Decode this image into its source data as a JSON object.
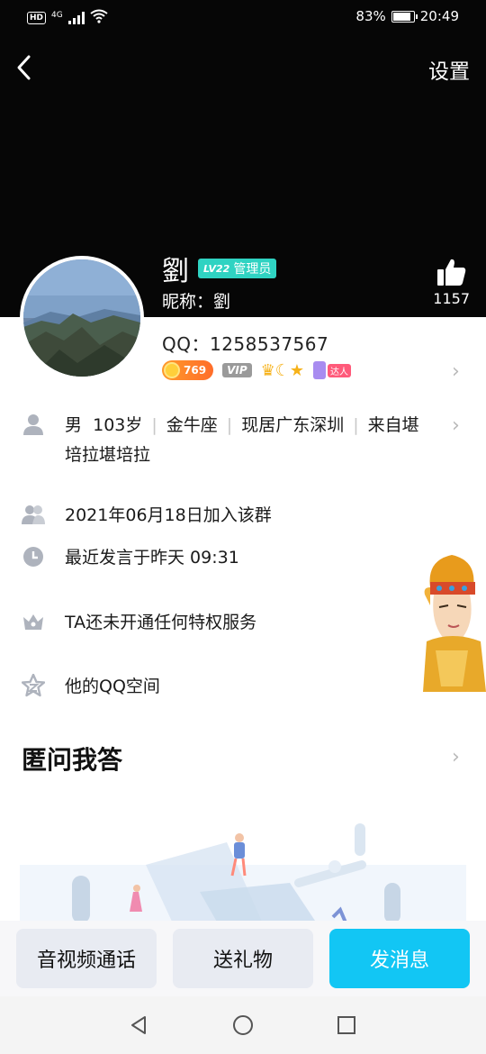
{
  "status": {
    "network": "4G",
    "hd": "HD",
    "battery": "83%",
    "time": "20:49",
    "battery_level": 0.83
  },
  "header": {
    "settings_label": "设置"
  },
  "profile": {
    "name": "劉",
    "level": "LV22",
    "role": "管理员",
    "nickname": "昵称：劉",
    "like_count": "1157",
    "qq": "QQ：1258537567",
    "coin_value": "769",
    "vip_label": "VIP",
    "daren_label": "达人"
  },
  "info": {
    "gender": "男",
    "age": "103岁",
    "zodiac": "金牛座",
    "residence": "现居广东深圳",
    "hometown": "来自堪",
    "hometown_cont": "培拉堪培拉",
    "join_date": "2021年06月18日加入该群",
    "last_speak": "最近发言于昨天 09:31",
    "privilege": "TA还未开通任何特权服务",
    "qzone": "他的QQ空间"
  },
  "qa": {
    "title": "匿问我答"
  },
  "actions": {
    "call_label": "音视频通话",
    "gift_label": "送礼物",
    "message_label": "发消息"
  },
  "colors": {
    "accent": "#12c6f4",
    "level_badge": "#2fd3c2",
    "header_bg": "#060606"
  }
}
